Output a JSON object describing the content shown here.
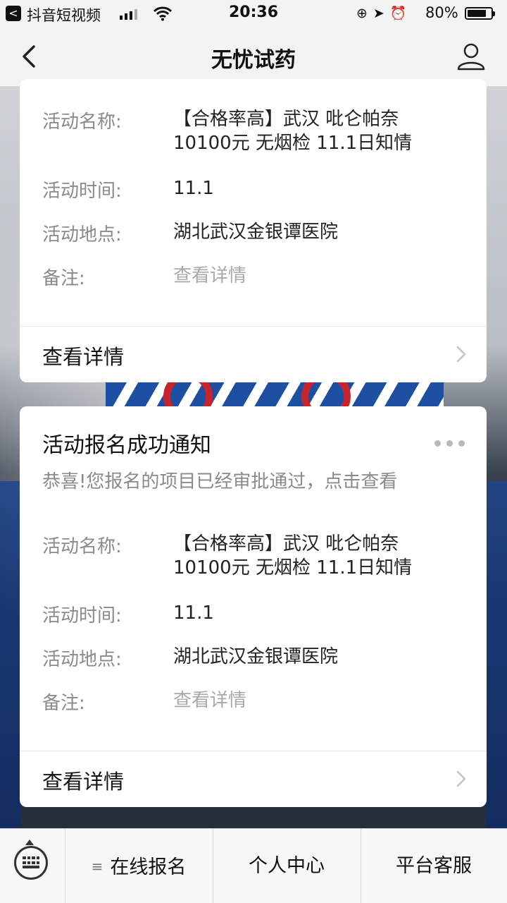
{
  "status_bar": {
    "back_app_glyph": "<",
    "app_name": "抖音短视频",
    "time": "20:36",
    "battery_pct": "80%",
    "battery_level": 0.8,
    "icons": [
      "back-app-icon",
      "signal-icon",
      "wifi-icon",
      "rotation-lock-icon",
      "location-icon",
      "alarm-icon",
      "battery-icon"
    ]
  },
  "nav": {
    "title": "无忧试药"
  },
  "card1": {
    "rows": [
      {
        "label": "活动名称:",
        "value": "【合格率高】武汉 吡仑帕奈 10100元 无烟检  11.1日知情"
      },
      {
        "label": "活动时间:",
        "value": "11.1"
      },
      {
        "label": "活动地点:",
        "value": "湖北武汉金银谭医院"
      },
      {
        "label": "备注:",
        "value": "查看详情"
      }
    ],
    "detail_label": "查看详情"
  },
  "card2": {
    "title": "活动报名成功通知",
    "subtitle": "恭喜!您报名的项目已经审批通过，点击查看",
    "rows": [
      {
        "label": "活动名称:",
        "value": "【合格率高】武汉 吡仑帕奈 10100元 无烟检  11.1日知情"
      },
      {
        "label": "活动时间:",
        "value": "11.1"
      },
      {
        "label": "活动地点:",
        "value": "湖北武汉金银谭医院"
      },
      {
        "label": "备注:",
        "value": "查看详情"
      }
    ],
    "detail_label": "查看详情"
  },
  "bottom_menu": {
    "items": [
      {
        "label": "在线报名",
        "has_submenu_icon": true
      },
      {
        "label": "个人中心"
      },
      {
        "label": "平台客服"
      }
    ],
    "submenu_glyph": "≡"
  },
  "colors": {
    "nav_bg": "#f3f3f3",
    "card_bg": "#ffffff",
    "muted_text": "#8a8a8a",
    "placeholder_text": "#a9a9a9"
  }
}
